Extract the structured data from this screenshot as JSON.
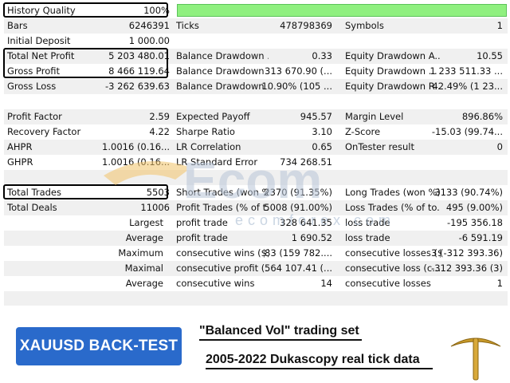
{
  "row_history": {
    "label": "History Quality",
    "value": "100%"
  },
  "row_bars": {
    "label": "Bars",
    "value": "6246391",
    "label2": "Ticks",
    "value2": "478798369",
    "label3": "Symbols",
    "value3": "1"
  },
  "row_deposit": {
    "label": "Initial Deposit",
    "value": "1 000.00"
  },
  "row_netprofit": {
    "label": "Total Net Profit",
    "value": "5 203 480.01",
    "label2": "Balance Drawdown ...",
    "value2": "0.33",
    "label3": "Equity Drawdown A...",
    "value3": "10.55"
  },
  "row_grossprofit": {
    "label": "Gross Profit",
    "value": "8 466 119.64",
    "label2": "Balance Drawdown ...",
    "value2": "313 670.90 (...",
    "label3": "Equity Drawdown ...",
    "value3": "1 233 511.33 ..."
  },
  "row_grossloss": {
    "label": "Gross Loss",
    "value": "-3 262 639.63",
    "label2": "Balance Drawdown ...",
    "value2": "10.90% (105 ...",
    "label3": "Equity Drawdown R...",
    "value3": "42.49% (1 23..."
  },
  "row_pf": {
    "label": "Profit Factor",
    "value": "2.59",
    "label2": "Expected Payoff",
    "value2": "945.57",
    "label3": "Margin Level",
    "value3": "896.86%"
  },
  "row_rf": {
    "label": "Recovery Factor",
    "value": "4.22",
    "label2": "Sharpe Ratio",
    "value2": "3.10",
    "label3": "Z-Score",
    "value3": "-15.03 (99.74..."
  },
  "row_ahpr": {
    "label": "AHPR",
    "value": "1.0016 (0.16...",
    "label2": "LR Correlation",
    "value2": "0.65",
    "label3": "OnTester result",
    "value3": "0"
  },
  "row_ghpr": {
    "label": "GHPR",
    "value": "1.0016 (0.16...",
    "label2": "LR Standard Error",
    "value2": "734 268.51"
  },
  "row_trades": {
    "label": "Total Trades",
    "value": "5503",
    "label2": "Short Trades (won %)",
    "value2": "2370 (91.35%)",
    "label3": "Long Trades (won %)",
    "value3": "3133 (90.74%)"
  },
  "row_deals": {
    "label": "Total Deals",
    "value": "11006",
    "label2": "Profit Trades (% of t...",
    "value2": "5008 (91.00%)",
    "label3": "Loss Trades (% of to...",
    "value3": "495 (9.00%)"
  },
  "row_largest": {
    "label": "Largest",
    "label2": "profit trade",
    "value2": "328 641.35",
    "label3": "loss trade",
    "value3": "-195 356.18"
  },
  "row_average": {
    "label": "Average",
    "label2": "profit trade",
    "value2": "1 690.52",
    "label3": "loss trade",
    "value3": "-6 591.19"
  },
  "row_maximum": {
    "label": "Maximum",
    "label2": "consecutive wins ($)",
    "value2": "83 (159 782....",
    "label3": "consecutive losses ($)",
    "value3": "3 (-312 393.36)"
  },
  "row_maximal": {
    "label": "Maximal",
    "label2": "consecutive profit (...",
    "value2": "564 107.41 (...",
    "label3": "consecutive loss (c...",
    "value3": "-312 393.36 (3)"
  },
  "row_avgcons": {
    "label": "Average",
    "label2": "consecutive wins",
    "value2": "14",
    "label3": "consecutive losses",
    "value3": "1"
  },
  "watermark": {
    "brand": "Ecom",
    "site": "ecomforex.com"
  },
  "footer": {
    "button_label": "XAUUSD BACK-TEST",
    "caption1": "\"Balanced Vol\" trading set",
    "caption2": "2005-2022 Dukascopy real tick data"
  },
  "colors": {
    "quality_bar": "#8ff07f",
    "button": "#2a6acb",
    "watermark": "#f2c46a"
  },
  "icons": {
    "footer_icon": "pickaxe-icon"
  }
}
